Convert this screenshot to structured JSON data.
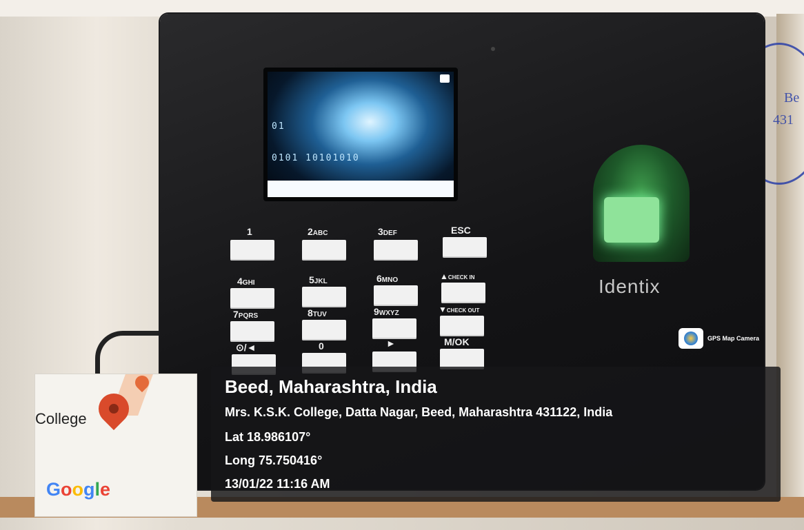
{
  "device": {
    "brand": "Identix",
    "keys": [
      {
        "label": "1",
        "sub": ""
      },
      {
        "label": "2",
        "sub": "ABC"
      },
      {
        "label": "3",
        "sub": "DEF"
      },
      {
        "label": "ESC",
        "sub": ""
      },
      {
        "label": "4",
        "sub": "GHI"
      },
      {
        "label": "5",
        "sub": "JKL"
      },
      {
        "label": "6",
        "sub": "MNO"
      },
      {
        "label": "▲",
        "sub": "CHECK IN"
      },
      {
        "label": "7",
        "sub": "PQRS"
      },
      {
        "label": "8",
        "sub": "TUV"
      },
      {
        "label": "9",
        "sub": "WXYZ"
      },
      {
        "label": "▼",
        "sub": "CHECK OUT"
      },
      {
        "label": "⊙/◄",
        "sub": ""
      },
      {
        "label": "0",
        "sub": ""
      },
      {
        "label": "►",
        "sub": ""
      },
      {
        "label": "M/OK",
        "sub": ""
      }
    ],
    "screen_bits_top": "01",
    "screen_bits_bottom": "0101 10101010"
  },
  "camera_badge": {
    "label": "GPS Map Camera",
    "icon": "camera-app-icon"
  },
  "overlay": {
    "title": "Beed, Maharashtra, India",
    "address": "Mrs. K.S.K. College, Datta Nagar, Beed, Maharashtra 431122, India",
    "lat": "Lat 18.986107°",
    "long": "Long 75.750416°",
    "datetime": "13/01/22 11:16 AM"
  },
  "map": {
    "place_label": "College",
    "provider": "Google",
    "pin_icon": "map-pin-icon"
  },
  "seal": {
    "text_1": "Be",
    "text_2": "431"
  }
}
